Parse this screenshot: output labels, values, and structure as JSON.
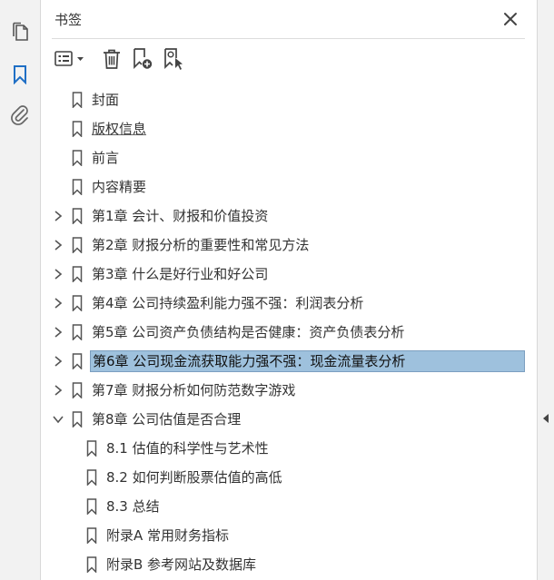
{
  "panel": {
    "title": "书签",
    "close_icon": "close-icon"
  },
  "left_rail": {
    "items": [
      {
        "icon": "pages-icon"
      },
      {
        "icon": "bookmark-icon",
        "active": true
      },
      {
        "icon": "paperclip-icon"
      }
    ]
  },
  "toolbar": {
    "items": [
      {
        "icon": "options-menu-icon"
      },
      {
        "icon": "trash-icon"
      },
      {
        "icon": "new-bookmark-icon"
      },
      {
        "icon": "find-bookmark-icon"
      }
    ]
  },
  "bookmarks": [
    {
      "label": "封面",
      "level": 0,
      "expander": "none"
    },
    {
      "label": "版权信息",
      "level": 0,
      "expander": "none",
      "underlined": true
    },
    {
      "label": "前言",
      "level": 0,
      "expander": "none"
    },
    {
      "label": "内容精要",
      "level": 0,
      "expander": "none"
    },
    {
      "label": "第1章 会计、财报和价值投资",
      "level": 0,
      "expander": "collapsed"
    },
    {
      "label": "第2章 财报分析的重要性和常见方法",
      "level": 0,
      "expander": "collapsed"
    },
    {
      "label": "第3章 什么是好行业和好公司",
      "level": 0,
      "expander": "collapsed"
    },
    {
      "label": "第4章 公司持续盈利能力强不强：利润表分析",
      "level": 0,
      "expander": "collapsed"
    },
    {
      "label": "第5章 公司资产负债结构是否健康：资产负债表分析",
      "level": 0,
      "expander": "collapsed"
    },
    {
      "label": "第6章 公司现金流获取能力强不强：现金流量表分析",
      "level": 0,
      "expander": "collapsed",
      "selected": true
    },
    {
      "label": "第7章 财报分析如何防范数字游戏",
      "level": 0,
      "expander": "collapsed"
    },
    {
      "label": "第8章 公司估值是否合理",
      "level": 0,
      "expander": "expanded"
    },
    {
      "label": "8.1 估值的科学性与艺术性",
      "level": 1,
      "expander": "none"
    },
    {
      "label": "8.2 如何判断股票估值的高低",
      "level": 1,
      "expander": "none"
    },
    {
      "label": "8.3 总结",
      "level": 1,
      "expander": "none"
    },
    {
      "label": "附录A 常用财务指标",
      "level": 1,
      "expander": "none"
    },
    {
      "label": "附录B 参考网站及数据库",
      "level": 1,
      "expander": "none"
    }
  ],
  "colors": {
    "accent": "#1f6fc5",
    "selection": "#9ec1dd"
  }
}
